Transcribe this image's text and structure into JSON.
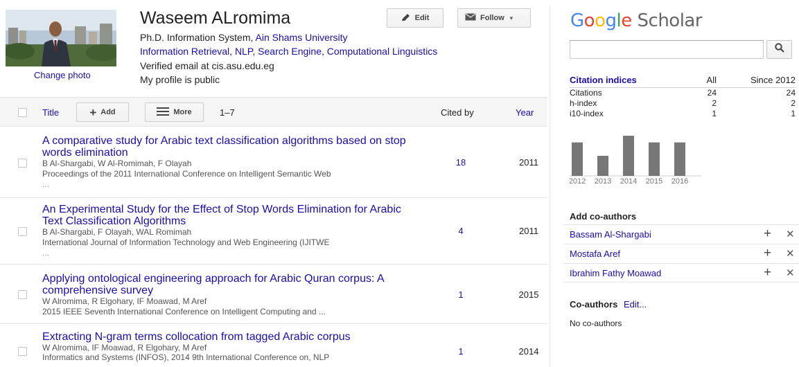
{
  "profile": {
    "name": "Waseem ALromima",
    "change_photo": "Change photo",
    "affiliation_prefix": "Ph.D. Information System, ",
    "affiliation_link": "Ain Shams University",
    "interests": "Information Retrieval, NLP, Search Engine, Computational Linguistics",
    "email": "Verified email at cis.asu.edu.eg",
    "visibility": "My profile is public",
    "edit_label": "Edit",
    "follow_label": "Follow"
  },
  "table": {
    "title_header": "Title",
    "add_label": "Add",
    "more_label": "More",
    "range": "1–7",
    "cited_by_header": "Cited by",
    "year_header": "Year"
  },
  "articles": [
    {
      "title": "A comparative study for Arabic text classification algorithms based on stop words elimination",
      "authors": "B Al-Shargabi, W Al-Romimah, F Olayah",
      "venue": "Proceedings of the 2011 International Conference on Intelligent Semantic Web",
      "venue_more": "...",
      "cited_by": "18",
      "year": "2011"
    },
    {
      "title": "An Experimental Study for the Effect of Stop Words Elimination for Arabic Text Classification Algorithms",
      "authors": "B Al-Shargabi, F Olayah, WAL Romimah",
      "venue": "International Journal of Information Technology and Web Engineering (IJITWE",
      "venue_more": "...",
      "cited_by": "4",
      "year": "2011"
    },
    {
      "title": "Applying ontological engineering approach for Arabic Quran corpus: A comprehensive survey",
      "authors": "W Alromima, R Elgohary, IF Moawad, M Aref",
      "venue": "2015 IEEE Seventh International Conference on Intelligent Computing and ...",
      "venue_more": "",
      "cited_by": "1",
      "year": "2015"
    },
    {
      "title": "Extracting N-gram terms collocation from tagged Arabic corpus",
      "authors": "W Alromima, IF Moawad, R Elgohary, M Aref",
      "venue": "Informatics and Systems (INFOS), 2014 9th International Conference on, NLP",
      "venue_more": "",
      "cited_by": "1",
      "year": "2014"
    }
  ],
  "sidebar": {
    "logo_google": "Google",
    "logo_scholar": "Scholar",
    "search_placeholder": "",
    "citation_indices": {
      "header": "Citation indices",
      "col_all": "All",
      "col_since": "Since 2012",
      "rows": [
        {
          "label": "Citations",
          "all": "24",
          "since": "24"
        },
        {
          "label": "h-index",
          "all": "2",
          "since": "2"
        },
        {
          "label": "i10-index",
          "all": "1",
          "since": "1"
        }
      ]
    },
    "add_coauthors_title": "Add co-authors",
    "suggested_coauthors": [
      "Bassam Al-Shargabi",
      "Mostafa Aref",
      "Ibrahim Fathy Moawad"
    ],
    "coauthors_title": "Co-authors",
    "coauthors_edit": "Edit...",
    "no_coauthors": "No co-authors"
  },
  "chart_data": {
    "type": "bar",
    "categories": [
      "2012",
      "2013",
      "2014",
      "2015",
      "2016"
    ],
    "values": [
      5,
      3,
      6,
      5,
      5
    ],
    "ylim": [
      0,
      6
    ],
    "bar_color": "#777777",
    "grid": false
  },
  "colors": {
    "link": "#1a0dab",
    "header_bg": "#f5f5f5",
    "bar": "#777777"
  }
}
